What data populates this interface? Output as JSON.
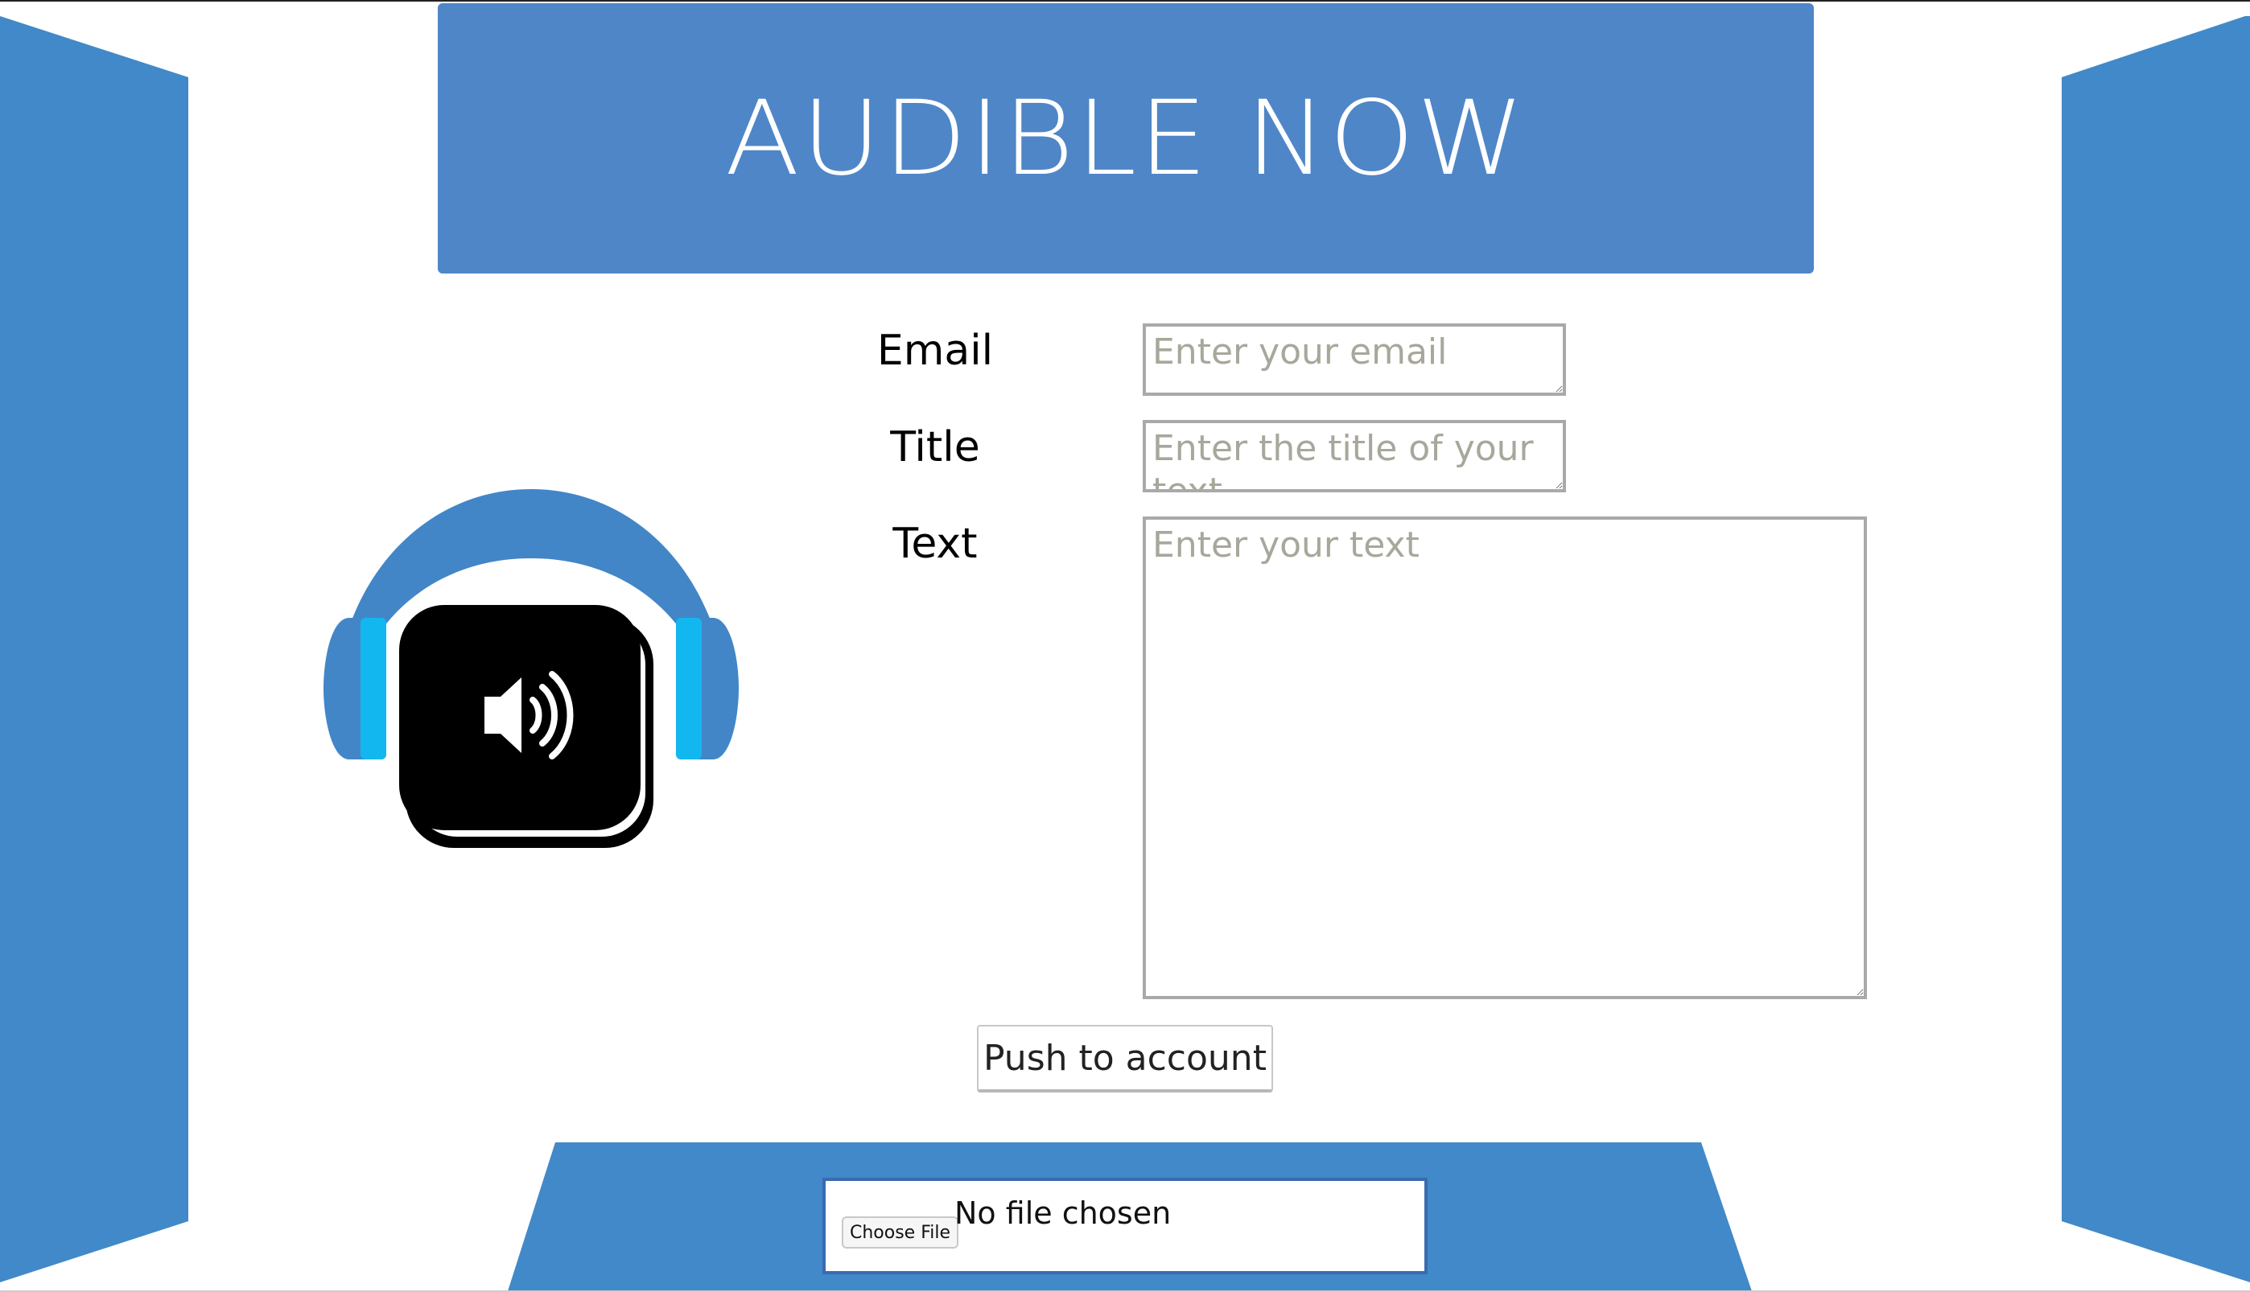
{
  "colors": {
    "brand_blue": "#4f86c7",
    "side_blue": "#4189c8",
    "headphone_blue": "#4286c8",
    "earpad_cyan": "#13b7ef",
    "background": "#ffffff"
  },
  "header": {
    "title": "AUDIBLE NOW"
  },
  "logo": {
    "icon": "headphones-speaker-icon"
  },
  "form": {
    "email": {
      "label": "Email",
      "placeholder": "Enter your email",
      "value": ""
    },
    "title": {
      "label": "Title",
      "placeholder": "Enter the title of your text",
      "value": ""
    },
    "text": {
      "label": "Text",
      "placeholder": "Enter your text",
      "value": ""
    },
    "submit_label": "Push to account"
  },
  "upload": {
    "button_label": "Choose File",
    "status": "No file chosen"
  }
}
